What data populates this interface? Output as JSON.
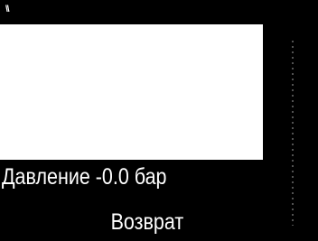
{
  "header": {
    "label": "\\\\"
  },
  "status": {
    "text": "Давление -0.0 бар"
  },
  "actions": {
    "return_label": "Возврат"
  },
  "colors": {
    "background": "#000000",
    "display": "#ffffff",
    "text": "#ffffff"
  }
}
